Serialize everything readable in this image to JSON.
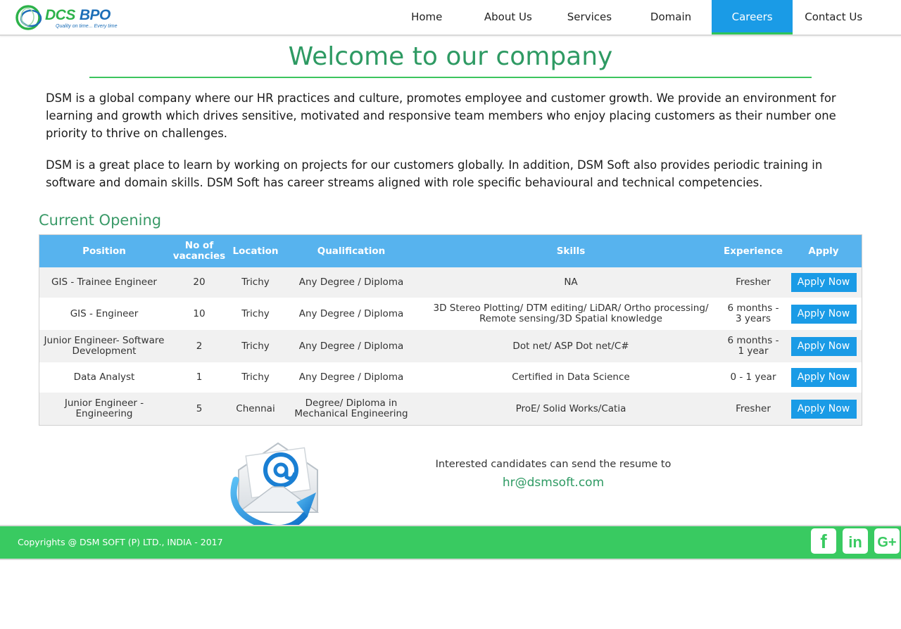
{
  "brand": {
    "name_part1": "DCS",
    "name_part2": "BPO",
    "tagline": "Quality on time... Every time"
  },
  "nav": {
    "items": [
      {
        "label": "Home"
      },
      {
        "label": "About Us"
      },
      {
        "label": "Services"
      },
      {
        "label": "Domain"
      },
      {
        "label": "Careers",
        "active": true
      },
      {
        "label": "Contact Us"
      }
    ]
  },
  "main": {
    "title": "Welcome to our company",
    "paragraphs": [
      "DSM is a global company where our HR practices and culture, promotes employee and customer growth. We provide an environment for learning and growth which drives sensitive, motivated and responsive team members who enjoy placing customers as their number one priority to thrive on challenges.",
      "DSM is a great place to learn by working on projects for our customers globally. In addition, DSM Soft also provides periodic training in software and domain skills. DSM Soft has career streams aligned with role specific behavioural and technical competencies."
    ],
    "openings_heading": "Current Opening"
  },
  "table": {
    "headers": [
      "Position",
      "No of vacancies",
      "Location",
      "Qualification",
      "Skills",
      "Experience",
      "Apply"
    ],
    "apply_label": "Apply Now",
    "rows": [
      {
        "position": "GIS - Trainee Engineer",
        "vacancies": "20",
        "location": "Trichy",
        "qualification": "Any Degree / Diploma",
        "skills": "NA",
        "experience": "Fresher"
      },
      {
        "position": "GIS - Engineer",
        "vacancies": "10",
        "location": "Trichy",
        "qualification": "Any Degree / Diploma",
        "skills": "3D Stereo Plotting/ DTM editing/ LiDAR/ Ortho processing/ Remote sensing/3D Spatial knowledge",
        "experience": "6 months - 3 years"
      },
      {
        "position": "Junior Engineer- Software Development",
        "vacancies": "2",
        "location": "Trichy",
        "qualification": "Any Degree / Diploma",
        "skills": "Dot net/ ASP Dot net/C#",
        "experience": "6 months - 1 year"
      },
      {
        "position": "Data Analyst",
        "vacancies": "1",
        "location": "Trichy",
        "qualification": "Any Degree / Diploma",
        "skills": "Certified in Data Science",
        "experience": "0 - 1 year"
      },
      {
        "position": "Junior Engineer - Engineering",
        "vacancies": "5",
        "location": "Chennai",
        "qualification": "Degree/ Diploma in Mechanical Engineering",
        "skills": "ProE/ Solid Works/Catia",
        "experience": "Fresher"
      }
    ]
  },
  "contact": {
    "text": "Interested candidates can send the resume to",
    "email": "hr@dsmsoft.com"
  },
  "footer": {
    "copyright": "Copyrights @ DSM SOFT (P) LTD., INDIA - 2017",
    "social": [
      {
        "icon": "facebook-icon",
        "glyph": "f"
      },
      {
        "icon": "linkedin-icon",
        "glyph": "in"
      },
      {
        "icon": "google-plus-icon",
        "glyph": "G+"
      }
    ]
  },
  "colors": {
    "accent_blue": "#1a9be6",
    "table_header": "#57b3ee",
    "heading_green": "#2e9a63",
    "footer_green": "#39ca61",
    "social_green": "#39ca61"
  }
}
